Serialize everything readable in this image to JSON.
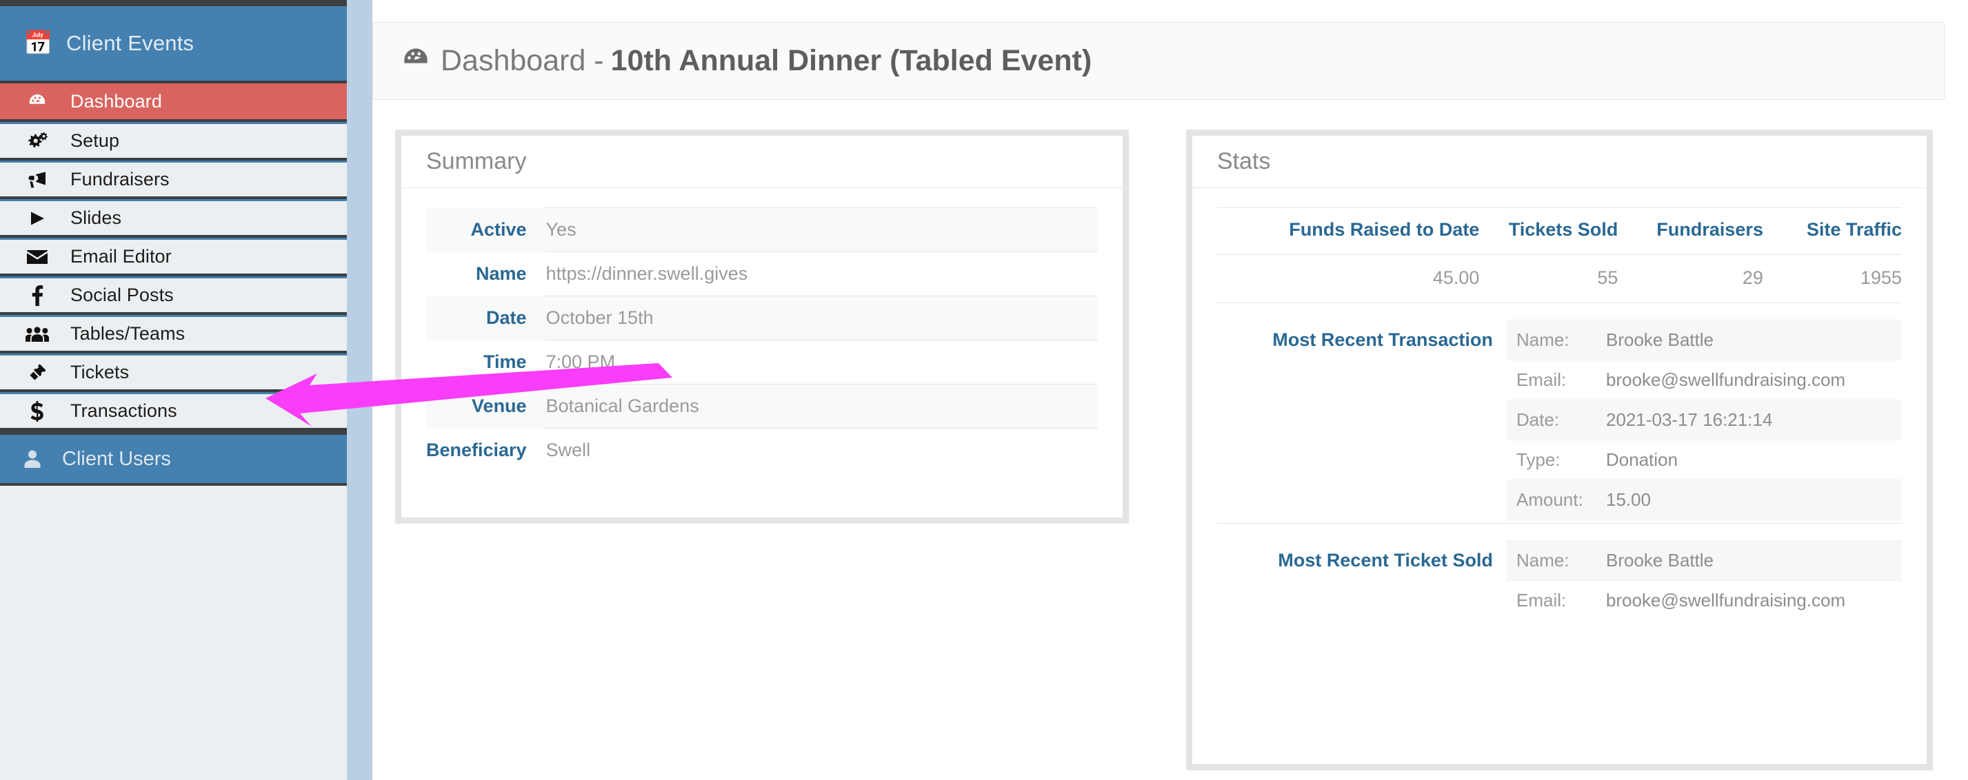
{
  "sidebar": {
    "brand": {
      "label": "Client Events",
      "icon": "calendar-icon"
    },
    "items": [
      {
        "label": "Dashboard",
        "icon": "dashboard-icon",
        "active": true
      },
      {
        "label": "Setup",
        "icon": "gears-icon",
        "active": false
      },
      {
        "label": "Fundraisers",
        "icon": "megaphone-icon",
        "active": false
      },
      {
        "label": "Slides",
        "icon": "play-icon",
        "active": false
      },
      {
        "label": "Email Editor",
        "icon": "envelope-icon",
        "active": false
      },
      {
        "label": "Social Posts",
        "icon": "facebook-icon",
        "active": false
      },
      {
        "label": "Tables/Teams",
        "icon": "users-icon",
        "active": false
      },
      {
        "label": "Tickets",
        "icon": "ticket-icon",
        "active": false
      },
      {
        "label": "Transactions",
        "icon": "dollar-icon",
        "active": false
      }
    ],
    "section": {
      "label": "Client Users",
      "icon": "user-icon"
    }
  },
  "header": {
    "icon": "dashboard-icon",
    "prefix": "Dashboard -",
    "event_name": "10th Annual Dinner (Tabled Event)"
  },
  "summary": {
    "title": "Summary",
    "rows": [
      {
        "label": "Active",
        "value": "Yes"
      },
      {
        "label": "Name",
        "value": "https://dinner.swell.gives"
      },
      {
        "label": "Date",
        "value": "October 15th"
      },
      {
        "label": "Time",
        "value": "7:00 PM"
      },
      {
        "label": "Venue",
        "value": "Botanical Gardens"
      },
      {
        "label": "Beneficiary",
        "value": "Swell"
      }
    ]
  },
  "stats": {
    "title": "Stats",
    "columns": [
      "Funds Raised to Date",
      "Tickets Sold",
      "Fundraisers",
      "Site Traffic"
    ],
    "values": [
      "45.00",
      "55",
      "29",
      "1955"
    ],
    "most_recent_transaction": {
      "label": "Most Recent Transaction",
      "rows": [
        {
          "key": "Name:",
          "value": "Brooke Battle"
        },
        {
          "key": "Email:",
          "value": "brooke@swellfundraising.com"
        },
        {
          "key": "Date:",
          "value": "2021-03-17 16:21:14"
        },
        {
          "key": "Type:",
          "value": "Donation"
        },
        {
          "key": "Amount:",
          "value": "15.00"
        }
      ]
    },
    "most_recent_ticket": {
      "label": "Most Recent Ticket Sold",
      "rows": [
        {
          "key": "Name:",
          "value": "Brooke Battle"
        },
        {
          "key": "Email:",
          "value": "brooke@swellfundraising.com"
        }
      ]
    }
  },
  "annotation": {
    "type": "arrow",
    "color": "#f93df9",
    "points_to": "Email Editor"
  },
  "colors": {
    "sidebar_brand": "#4480b0",
    "sidebar_active": "#d9645f",
    "sidebar_bg": "#eceff1",
    "page_bg": "#b9d0e4",
    "label_blue": "#2a6893",
    "value_gray": "#9a9a9a"
  }
}
